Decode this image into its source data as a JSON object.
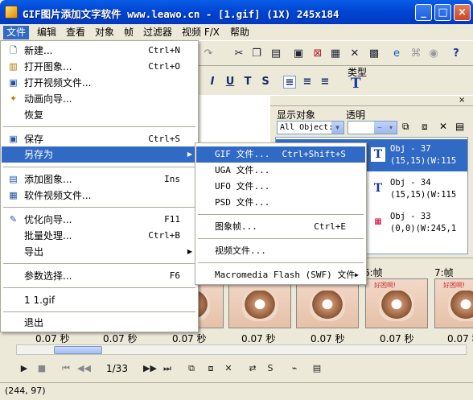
{
  "window": {
    "title": "GIF图片添加文字软件 www.leawo.cn - [1.gif] (1X) 245x184",
    "controls": {
      "minimize": "_",
      "maximize": "□",
      "close": "×"
    }
  },
  "menubar": [
    "文件",
    "编辑",
    "查看",
    "对象",
    "帧",
    "过滤器",
    "视频 F/X",
    "帮助"
  ],
  "file_menu": {
    "items": [
      {
        "label": "新建...",
        "shortcut": "Ctrl+N",
        "icon": "new-document-icon"
      },
      {
        "label": "打开图象...",
        "shortcut": "Ctrl+O",
        "icon": "open-image-icon"
      },
      {
        "label": "打开视频文件...",
        "shortcut": "",
        "icon": "open-video-icon"
      },
      {
        "label": "动画向导...",
        "shortcut": "",
        "icon": "wizard-icon"
      },
      {
        "label": "恢复",
        "shortcut": ""
      },
      {
        "label": "保存",
        "shortcut": "Ctrl+S",
        "icon": "save-icon"
      },
      {
        "label": "另存为",
        "shortcut": "",
        "submenu": true
      },
      {
        "label": "添加图象...",
        "shortcut": "Ins",
        "icon": "add-image-icon"
      },
      {
        "label": "软件视频文件...",
        "shortcut": "",
        "icon": "video-file-icon"
      },
      {
        "label": "优化向导...",
        "shortcut": "F11",
        "icon": "optimize-icon"
      },
      {
        "label": "批量处理...",
        "shortcut": "Ctrl+B"
      },
      {
        "label": "导出",
        "shortcut": "",
        "submenu": true
      },
      {
        "label": "参数选择...",
        "shortcut": "F6"
      },
      {
        "label": "1 1.gif",
        "shortcut": ""
      },
      {
        "label": "退出",
        "shortcut": ""
      }
    ]
  },
  "saveas_menu": {
    "items": [
      {
        "label": "GIF 文件...",
        "shortcut": "Ctrl+Shift+S"
      },
      {
        "label": "UGA 文件...",
        "shortcut": ""
      },
      {
        "label": "UFO 文件...",
        "shortcut": ""
      },
      {
        "label": "PSD 文件...",
        "shortcut": ""
      },
      {
        "label": "图象帧...",
        "shortcut": "Ctrl+E"
      },
      {
        "label": "视频文件...",
        "shortcut": ""
      },
      {
        "label": "Macromedia Flash (SWF) 文件",
        "shortcut": ""
      }
    ]
  },
  "toolbar": {
    "type_label": "类型"
  },
  "object_panel": {
    "show_label": "显示对象",
    "opacity_label": "透明",
    "filter_value": "All Object:",
    "opacity_value": "",
    "objects": [
      {
        "name": "Obj - 37",
        "info": "(15,15)(W:115",
        "icon": "T"
      },
      {
        "name": "Obj - 34",
        "info": "(15,15)(W:115",
        "icon": "T"
      },
      {
        "name": "Obj - 33",
        "info": "(0,0)(W:245,1",
        "icon": "img"
      }
    ]
  },
  "frames": {
    "titles": [
      "6:帧",
      "7:帧"
    ],
    "thumb_caption": "好困啊!",
    "times": [
      "0.07 秒",
      "0.07 秒",
      "0.07 秒",
      "0.07 秒",
      "0.07 秒",
      "0.07 秒",
      "0.07 秒"
    ]
  },
  "playback": {
    "counter": "1/33"
  },
  "status": {
    "coords": "(244, 97)"
  }
}
